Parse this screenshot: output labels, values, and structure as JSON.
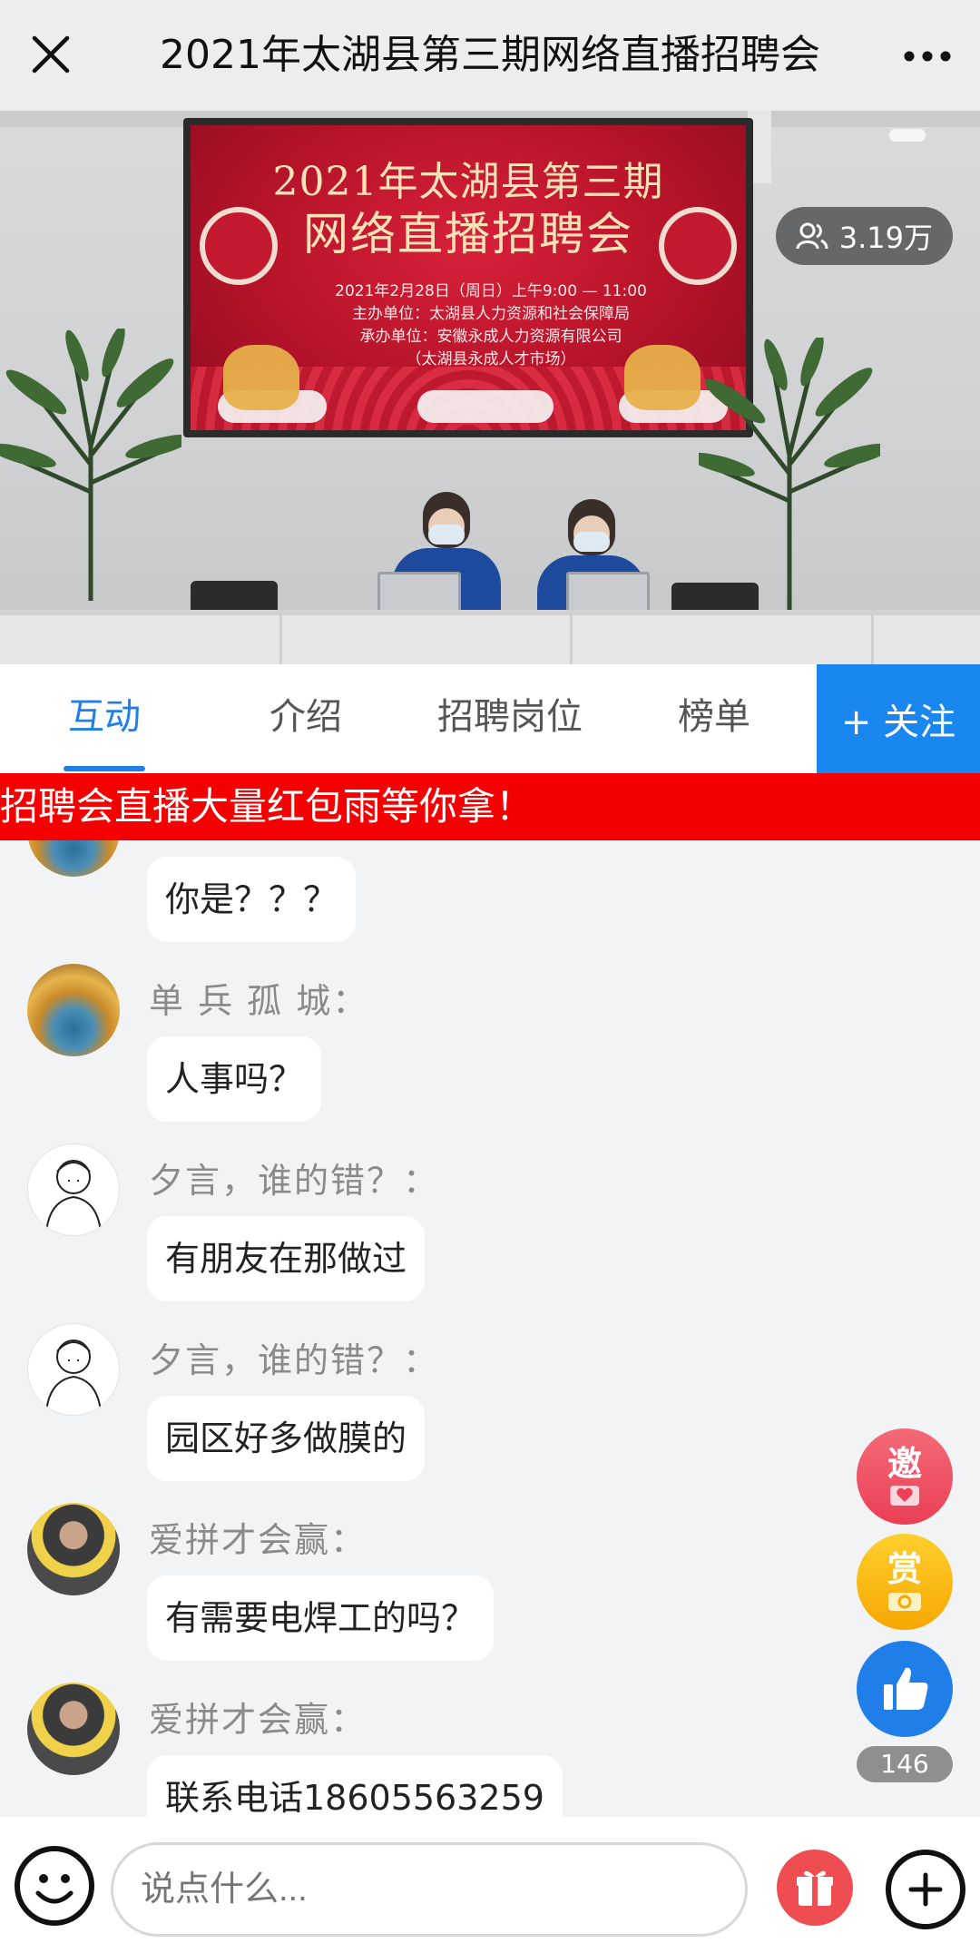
{
  "topbar": {
    "title": "2021年太湖县第三期网络直播招聘会",
    "close_icon": "close-icon",
    "more_icon": "more-icon"
  },
  "video": {
    "screen_title_line1": "2021年太湖县第三期",
    "screen_title_line2": "网络直播招聘会",
    "screen_date": "2021年2月28日（周日）上午9:00 — 11:00",
    "screen_host": "主办单位：太湖县人力资源和社会保障局",
    "screen_organizer": "承办单位：安徽永成人力资源有限公司",
    "screen_market": "（太湖县永成人才市场）",
    "viewer_count": "3.19万"
  },
  "tabs": [
    {
      "label": "互动",
      "active": true
    },
    {
      "label": "介绍",
      "active": false
    },
    {
      "label": "招聘岗位",
      "active": false
    },
    {
      "label": "榜单",
      "active": false
    }
  ],
  "follow_button": "+ 关注",
  "banner": "招聘会直播大量红包雨等你拿！",
  "messages": [
    {
      "user": "",
      "text": "你是？？？",
      "avatar": "forest"
    },
    {
      "user": "单 兵 孤 城：",
      "text": "人事吗？",
      "avatar": "forest"
    },
    {
      "user": "夕言，谁的错？：",
      "text": "有朋友在那做过",
      "avatar": "sketch"
    },
    {
      "user": "夕言，谁的错？：",
      "text": "园区好多做膜的",
      "avatar": "sketch"
    },
    {
      "user": "爱拼才会赢：",
      "text": "有需要电焊工的吗？",
      "avatar": "photo"
    },
    {
      "user": "爱拼才会赢：",
      "text": "联系电话18605563259",
      "avatar": "photo"
    }
  ],
  "side_buttons": {
    "invite": "邀",
    "reward": "赏",
    "like_count": "146"
  },
  "bottombar": {
    "input_placeholder": "说点什么..."
  },
  "colors": {
    "accent": "#1f7ee8",
    "banner_red": "#f40000",
    "gift_red": "#ee4e51"
  }
}
